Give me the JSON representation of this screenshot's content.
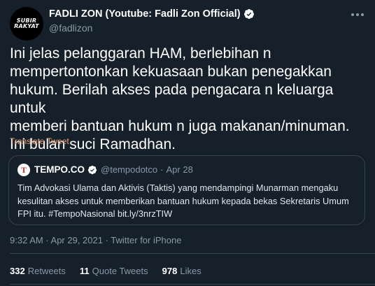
{
  "author": {
    "avatar_text": "SUBIR RAKYAT",
    "display_name": "FADLI ZON (Youtube: Fadli Zon Official)",
    "handle": "@fadlizon"
  },
  "tweet": {
    "text": "Ini jelas pelanggaran HAM, berlebihan n\nmempertontonkan kekuasaan bukan penegakkan\nhukum. Berilah akses pada pengacara n keluarga untuk\nmemberi bantuan hukum n juga makanan/minuman.\nIni bulan suci Ramadhan.",
    "translate_label": "Translate Tweet"
  },
  "quote": {
    "logo_letter": "T",
    "name": "TEMPO.CO",
    "handle": "@tempodotco",
    "separator": "·",
    "date": "Apr 28",
    "text": "Tim Advokasi Ulama dan Aktivis (Taktis) yang mendampingi Munarman mengaku kesulitan akses untuk memberikan bantuan hukum kepada bekas Sekretaris Umum FPI itu. #TempoNasional bit.ly/3nrzTIW"
  },
  "meta": {
    "timestamp": "9:32 AM · Apr 29, 2021 · Twitter for iPhone"
  },
  "stats": {
    "retweets_count": "332",
    "retweets_label": "Retweets",
    "quotes_count": "11",
    "quotes_label": "Quote Tweets",
    "likes_count": "978",
    "likes_label": "Likes"
  },
  "colors": {
    "background": "#15202b",
    "verified": "#1da1f2",
    "secondary_text": "#8899a6",
    "border": "#38444d"
  }
}
